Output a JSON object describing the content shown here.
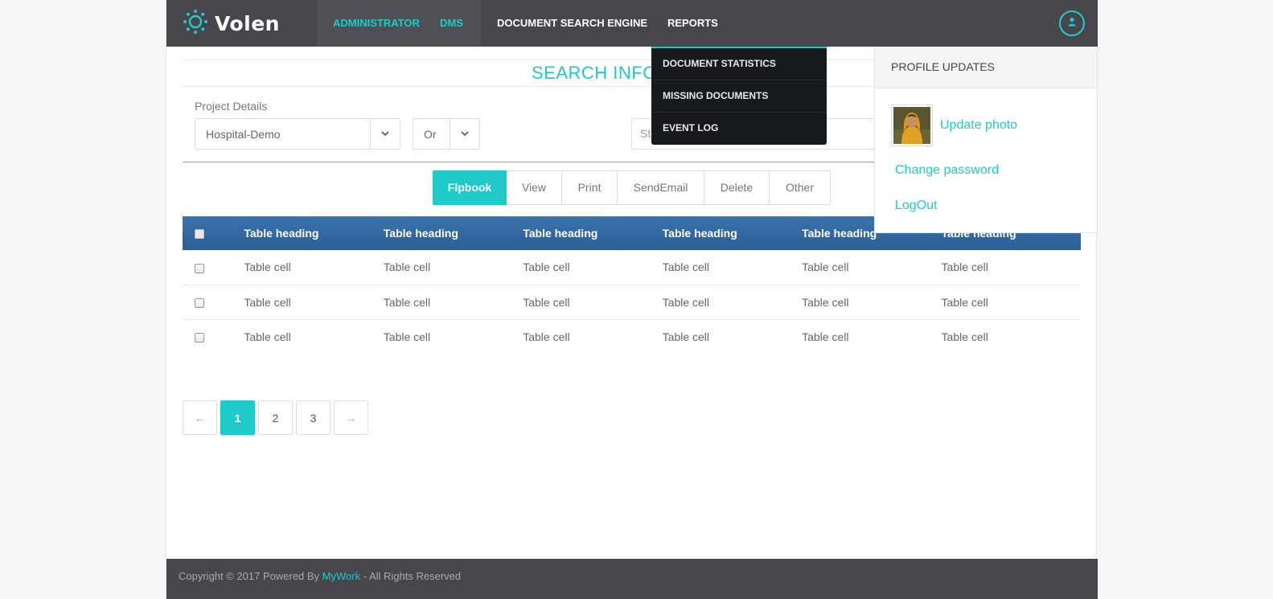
{
  "brand": {
    "name": "Volen"
  },
  "nav": {
    "items": [
      {
        "label": "ADMINISTRATOR"
      },
      {
        "label": "DMS"
      },
      {
        "label": "DOCUMENT SEARCH ENGINE"
      },
      {
        "label": "REPORTS"
      }
    ]
  },
  "reports_menu": {
    "items": [
      {
        "label": "DOCUMENT STATISTICS"
      },
      {
        "label": "MISSING DOCUMENTS"
      },
      {
        "label": "EVENT LOG"
      }
    ]
  },
  "profile_panel": {
    "title": "PROFILE UPDATES",
    "update_photo": "Update photo",
    "change_password": "Change password",
    "logout": "LogOut"
  },
  "search": {
    "title": "SEARCH INFO",
    "project_label": "Project Details",
    "project_value": "Hospital-Demo",
    "operator_value": "Or",
    "status_text": "St"
  },
  "actions": {
    "buttons": [
      {
        "label": "Flpbook",
        "active": true
      },
      {
        "label": "View"
      },
      {
        "label": "Print"
      },
      {
        "label": "SendEmail"
      },
      {
        "label": "Delete"
      },
      {
        "label": "Other"
      }
    ]
  },
  "table": {
    "headers": [
      "Table heading",
      "Table heading",
      "Table heading",
      "Table heading",
      "Table heading",
      "Table heading"
    ],
    "rows": [
      [
        "Table cell",
        "Table cell",
        "Table cell",
        "Table cell",
        "Table cell",
        "Table cell"
      ],
      [
        "Table cell",
        "Table cell",
        "Table cell",
        "Table cell",
        "Table cell",
        "Table cell"
      ],
      [
        "Table cell",
        "Table cell",
        "Table cell",
        "Table cell",
        "Table cell",
        "Table cell"
      ]
    ]
  },
  "pagination": {
    "prev": "←",
    "pages": [
      "1",
      "2",
      "3"
    ],
    "next": "→",
    "current": "1"
  },
  "footer": {
    "prefix": "Copyright © 2017 Powered By ",
    "brand": "MyWork",
    "suffix": " - All Rights Reserved"
  },
  "colors": {
    "accent": "#1ecbc9",
    "navbar": "#48464c",
    "table_header": "#3a73ad",
    "dropdown": "#171a1c"
  }
}
